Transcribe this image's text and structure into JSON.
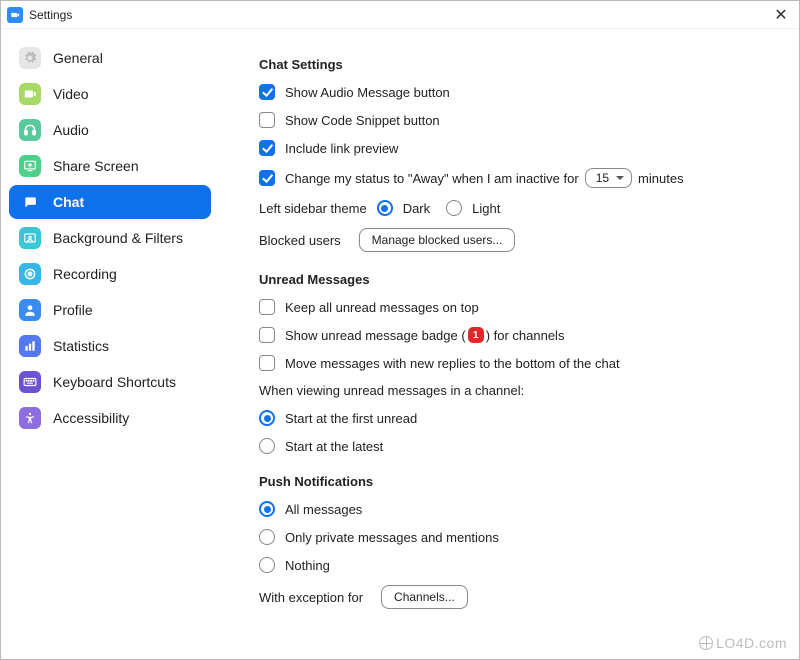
{
  "window": {
    "title": "Settings"
  },
  "sidebar": {
    "items": [
      {
        "label": "General",
        "icon": "gear-icon",
        "bg": "#e6e6e6",
        "fg": "#bdbdbd"
      },
      {
        "label": "Video",
        "icon": "video-icon",
        "bg": "#a7d966",
        "fg": "#ffffff"
      },
      {
        "label": "Audio",
        "icon": "headphones-icon",
        "bg": "#57c99b",
        "fg": "#ffffff"
      },
      {
        "label": "Share Screen",
        "icon": "share-screen-icon",
        "bg": "#4dd18a",
        "fg": "#ffffff"
      },
      {
        "label": "Chat",
        "icon": "chat-icon",
        "bg": "#0e72ed",
        "fg": "#ffffff",
        "active": true
      },
      {
        "label": "Background & Filters",
        "icon": "background-icon",
        "bg": "#38c6d9",
        "fg": "#ffffff"
      },
      {
        "label": "Recording",
        "icon": "record-icon",
        "bg": "#35b7e8",
        "fg": "#ffffff"
      },
      {
        "label": "Profile",
        "icon": "profile-icon",
        "bg": "#3b8cf0",
        "fg": "#ffffff"
      },
      {
        "label": "Statistics",
        "icon": "statistics-icon",
        "bg": "#5478f0",
        "fg": "#ffffff"
      },
      {
        "label": "Keyboard Shortcuts",
        "icon": "keyboard-icon",
        "bg": "#6c52d6",
        "fg": "#ffffff"
      },
      {
        "label": "Accessibility",
        "icon": "accessibility-icon",
        "bg": "#8e6de0",
        "fg": "#ffffff"
      }
    ]
  },
  "chat": {
    "section1_title": "Chat Settings",
    "show_audio": {
      "label": "Show Audio Message button",
      "checked": true
    },
    "show_code": {
      "label": "Show Code Snippet button",
      "checked": false
    },
    "link_preview": {
      "label": "Include link preview",
      "checked": true
    },
    "away": {
      "prefix": "Change my status to \"Away\" when I am inactive for",
      "value": "15",
      "suffix": "minutes",
      "checked": true
    },
    "theme": {
      "label": "Left sidebar theme",
      "options": {
        "dark": "Dark",
        "light": "Light"
      },
      "selected": "dark"
    },
    "blocked": {
      "label": "Blocked users",
      "button": "Manage blocked users..."
    },
    "section2_title": "Unread Messages",
    "keep_top": {
      "label": "Keep all unread messages on top",
      "checked": false
    },
    "badge": {
      "prefix": "Show unread message badge (",
      "count": "1",
      "suffix": ") for channels",
      "checked": false
    },
    "move_bottom": {
      "label": "Move messages with new replies to the bottom of the chat",
      "checked": false
    },
    "viewing_label": "When viewing unread messages in a channel:",
    "viewing": {
      "first": "Start at the first unread",
      "latest": "Start at the latest",
      "selected": "first"
    },
    "section3_title": "Push Notifications",
    "push": {
      "all": "All messages",
      "private": "Only private messages and mentions",
      "nothing": "Nothing",
      "selected": "all"
    },
    "exception": {
      "label": "With exception for",
      "button": "Channels..."
    }
  },
  "watermark": "LO4D.com"
}
